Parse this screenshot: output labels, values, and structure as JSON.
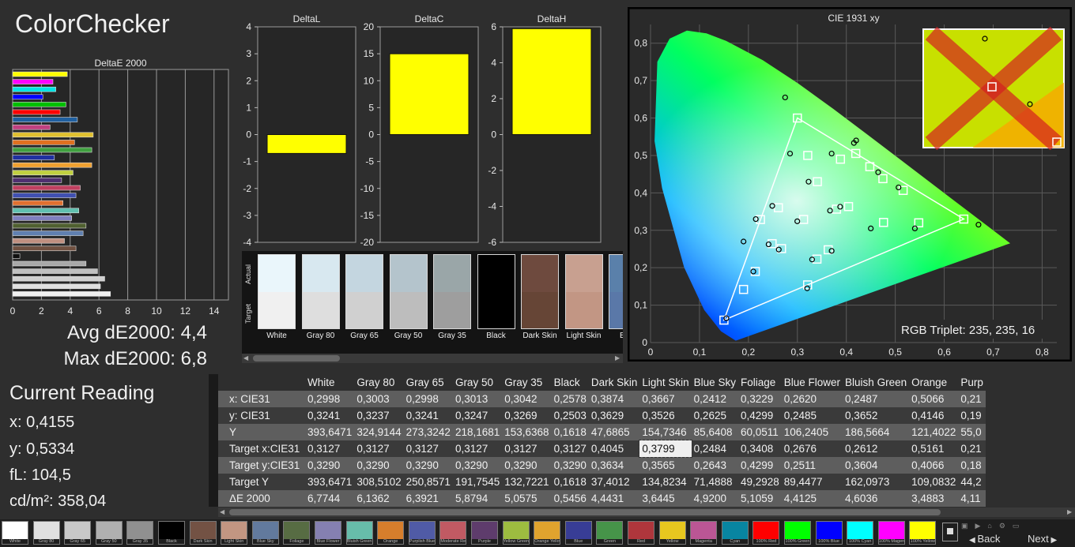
{
  "app": {
    "title": "ColorChecker"
  },
  "colors": {
    "accent_yellow": "#ffff00",
    "background": "#2e2e2e",
    "grid": "#9a9a9a"
  },
  "summary": {
    "avg": "Avg dE2000: 4,4",
    "max": "Max dE2000: 6,8"
  },
  "current_reading": {
    "title": "Current Reading",
    "x": "x: 0,4155",
    "y": "y: 0,5334",
    "fl": "fL: 104,5",
    "cdm2": "cd/m²: 358,04"
  },
  "chart_data": [
    {
      "type": "bar",
      "orientation": "horizontal",
      "title": "DeltaE 2000",
      "xlim": [
        0,
        15
      ],
      "xticks": [
        "0",
        "2",
        "4",
        "6",
        "8",
        "10",
        "12",
        "14"
      ],
      "bars": [
        {
          "color": "#ffff00",
          "value": 3.8
        },
        {
          "color": "#ff00ff",
          "value": 2.8
        },
        {
          "color": "#00e5e5",
          "value": 3.0
        },
        {
          "color": "#0000ff",
          "value": 2.1
        },
        {
          "color": "#00c000",
          "value": 3.7
        },
        {
          "color": "#ff0000",
          "value": 3.3
        },
        {
          "color": "#2060a0",
          "value": 4.5
        },
        {
          "color": "#c04080",
          "value": 2.6
        },
        {
          "color": "#e0c030",
          "value": 5.6
        },
        {
          "color": "#e07020",
          "value": 4.3
        },
        {
          "color": "#40a040",
          "value": 5.5
        },
        {
          "color": "#2030a0",
          "value": 2.9
        },
        {
          "color": "#f0a030",
          "value": 5.5
        },
        {
          "color": "#c0d040",
          "value": 4.2
        },
        {
          "color": "#503070",
          "value": 3.4
        },
        {
          "color": "#c04060",
          "value": 4.7
        },
        {
          "color": "#4050b0",
          "value": 4.4
        },
        {
          "color": "#e07030",
          "value": 3.5
        },
        {
          "color": "#60c0b0",
          "value": 4.6
        },
        {
          "color": "#8080c0",
          "value": 4.1
        },
        {
          "color": "#506030",
          "value": 5.1
        },
        {
          "color": "#6080b0",
          "value": 4.9
        },
        {
          "color": "#c09080",
          "value": 3.6
        },
        {
          "color": "#705040",
          "value": 4.4
        },
        {
          "color": "#101010",
          "value": 0.5
        },
        {
          "color": "#a8a8a8",
          "value": 5.1
        },
        {
          "color": "#c0c0c0",
          "value": 5.9
        },
        {
          "color": "#d0d0d0",
          "value": 6.4
        },
        {
          "color": "#e0e0e0",
          "value": 6.1
        },
        {
          "color": "#f0f0f0",
          "value": 6.8
        }
      ]
    },
    {
      "type": "bar",
      "title": "DeltaL",
      "ylim": [
        -4,
        4
      ],
      "yticks": [
        "4",
        "3",
        "2",
        "1",
        "0",
        "-1",
        "-2",
        "-3",
        "-4"
      ],
      "values": [
        -0.7
      ]
    },
    {
      "type": "bar",
      "title": "DeltaC",
      "ylim": [
        -20,
        20
      ],
      "yticks": [
        "20",
        "15",
        "10",
        "5",
        "0",
        "-5",
        "-10",
        "-15",
        "-20"
      ],
      "values": [
        15
      ]
    },
    {
      "type": "bar",
      "title": "DeltaH",
      "ylim": [
        -6,
        6
      ],
      "yticks": [
        "6",
        "4",
        "2",
        "0",
        "-2",
        "-4",
        "-6"
      ],
      "values": [
        5.9
      ]
    },
    {
      "type": "scatter",
      "title": "CIE 1931 xy",
      "xlim": [
        0,
        0.83
      ],
      "ylim": [
        0,
        0.85
      ],
      "xticks": [
        "0",
        "0,1",
        "0,2",
        "0,3",
        "0,4",
        "0,5",
        "0,6",
        "0,7",
        "0,8"
      ],
      "yticks": [
        "0,8",
        "0,7",
        "0,6",
        "0,5",
        "0,4",
        "0,3",
        "0,2",
        "0,1",
        "0"
      ],
      "gamut": [
        [
          0.64,
          0.33
        ],
        [
          0.3,
          0.6
        ],
        [
          0.15,
          0.06
        ]
      ],
      "targets": [
        [
          0.3127,
          0.329
        ],
        [
          0.4045,
          0.3634
        ],
        [
          0.3799,
          0.3565
        ],
        [
          0.2484,
          0.2643
        ],
        [
          0.3408,
          0.4299
        ],
        [
          0.2676,
          0.2511
        ],
        [
          0.2612,
          0.3604
        ],
        [
          0.5161,
          0.4066
        ],
        [
          0.214,
          0.19
        ],
        [
          0.476,
          0.321
        ],
        [
          0.34,
          0.223
        ],
        [
          0.388,
          0.49
        ],
        [
          0.4747,
          0.438
        ],
        [
          0.19,
          0.142
        ],
        [
          0.3212,
          0.5
        ],
        [
          0.5479,
          0.32
        ],
        [
          0.448,
          0.47
        ],
        [
          0.363,
          0.248
        ],
        [
          0.3,
          0.6
        ],
        [
          0.64,
          0.33
        ],
        [
          0.15,
          0.06
        ],
        [
          0.4193,
          0.5053
        ],
        [
          0.3209,
          0.1541
        ],
        [
          0.2246,
          0.3287
        ]
      ],
      "measured": [
        [
          0.2998,
          0.3241
        ],
        [
          0.3874,
          0.3629
        ],
        [
          0.3667,
          0.3526
        ],
        [
          0.2412,
          0.2625
        ],
        [
          0.3229,
          0.4299
        ],
        [
          0.262,
          0.2485
        ],
        [
          0.2487,
          0.3652
        ],
        [
          0.5066,
          0.4146
        ],
        [
          0.21,
          0.19
        ],
        [
          0.45,
          0.305
        ],
        [
          0.33,
          0.222
        ],
        [
          0.37,
          0.505
        ],
        [
          0.465,
          0.455
        ],
        [
          0.19,
          0.27
        ],
        [
          0.285,
          0.505
        ],
        [
          0.54,
          0.305
        ],
        [
          0.42,
          0.54
        ],
        [
          0.37,
          0.245
        ],
        [
          0.275,
          0.655
        ],
        [
          0.67,
          0.315
        ],
        [
          0.155,
          0.065
        ],
        [
          0.4155,
          0.5334
        ],
        [
          0.32,
          0.145
        ],
        [
          0.215,
          0.33
        ]
      ],
      "annotation": "RGB Triplet: 235, 235, 16"
    }
  ],
  "swatches": {
    "actual_label": "Actual",
    "target_label": "Target",
    "items": [
      {
        "label": "White",
        "actual": "#eaf6fb",
        "target": "#f0f0f0"
      },
      {
        "label": "Gray 80",
        "actual": "#d8e8f0",
        "target": "#dedede"
      },
      {
        "label": "Gray 65",
        "actual": "#c4d6e0",
        "target": "#d0d0d0"
      },
      {
        "label": "Gray 50",
        "actual": "#b4c4cc",
        "target": "#bdbdbd"
      },
      {
        "label": "Gray 35",
        "actual": "#9aa6a8",
        "target": "#9e9e9e"
      },
      {
        "label": "Black",
        "actual": "#000000",
        "target": "#000000"
      },
      {
        "label": "Dark Skin",
        "actual": "#6e4a3e",
        "target": "#664536"
      },
      {
        "label": "Light Skin",
        "actual": "#c8a090",
        "target": "#c29684"
      },
      {
        "label": "Blue",
        "actual": "#5a80aa",
        "target": "#5a78a8"
      }
    ]
  },
  "table": {
    "columns": [
      "",
      "White",
      "Gray 80",
      "Gray 65",
      "Gray 50",
      "Gray 35",
      "Black",
      "Dark Skin",
      "Light Skin",
      "Blue Sky",
      "Foliage",
      "Blue Flower",
      "Bluish Green",
      "Orange",
      "Purp"
    ],
    "rows": [
      {
        "label": "x: CIE31",
        "cells": [
          "0,2998",
          "0,3003",
          "0,2998",
          "0,3013",
          "0,3042",
          "0,2578",
          "0,3874",
          "0,3667",
          "0,2412",
          "0,3229",
          "0,2620",
          "0,2487",
          "0,5066",
          "0,21"
        ]
      },
      {
        "label": "y: CIE31",
        "cells": [
          "0,3241",
          "0,3237",
          "0,3241",
          "0,3247",
          "0,3269",
          "0,2503",
          "0,3629",
          "0,3526",
          "0,2625",
          "0,4299",
          "0,2485",
          "0,3652",
          "0,4146",
          "0,19"
        ]
      },
      {
        "label": "Y",
        "cells": [
          "393,6471",
          "324,9144",
          "273,3242",
          "218,1681",
          "153,6368",
          "0,1618",
          "47,6865",
          "154,7346",
          "85,6408",
          "60,0511",
          "106,2405",
          "186,5664",
          "121,4022",
          "55,0"
        ]
      },
      {
        "label": "Target x:CIE31",
        "cells": [
          "0,3127",
          "0,3127",
          "0,3127",
          "0,3127",
          "0,3127",
          "0,3127",
          "0,4045",
          "0,3799",
          "0,2484",
          "0,3408",
          "0,2676",
          "0,2612",
          "0,5161",
          "0,21"
        ]
      },
      {
        "label": "Target y:CIE31",
        "cells": [
          "0,3290",
          "0,3290",
          "0,3290",
          "0,3290",
          "0,3290",
          "0,3290",
          "0,3634",
          "0,3565",
          "0,2643",
          "0,4299",
          "0,2511",
          "0,3604",
          "0,4066",
          "0,18"
        ]
      },
      {
        "label": "Target Y",
        "cells": [
          "393,6471",
          "308,5102",
          "250,8571",
          "191,7545",
          "132,7221",
          "0,1618",
          "37,4012",
          "134,8234",
          "71,4888",
          "49,2928",
          "89,4477",
          "162,0973",
          "109,0832",
          "44,2"
        ]
      },
      {
        "label": "ΔE 2000",
        "cells": [
          "6,7744",
          "6,1362",
          "6,3921",
          "5,8794",
          "5,0575",
          "0,5456",
          "4,4431",
          "3,6445",
          "4,9200",
          "5,1059",
          "4,4125",
          "4,6036",
          "3,4883",
          "4,11"
        ]
      }
    ]
  },
  "strip": [
    {
      "label": "White",
      "color": "#ffffff"
    },
    {
      "label": "Gray 80",
      "color": "#e0e0e0"
    },
    {
      "label": "Gray 65",
      "color": "#c8c8c8"
    },
    {
      "label": "Gray 50",
      "color": "#b0b0b0"
    },
    {
      "label": "Gray 35",
      "color": "#909090"
    },
    {
      "label": "Black",
      "color": "#000000"
    },
    {
      "label": "Dark Skin",
      "color": "#735244"
    },
    {
      "label": "Light Skin",
      "color": "#c29682"
    },
    {
      "label": "Blue Sky",
      "color": "#627a9d"
    },
    {
      "label": "Foliage",
      "color": "#576c43"
    },
    {
      "label": "Blue Flower",
      "color": "#8580b1"
    },
    {
      "label": "Bluish Green",
      "color": "#67bdaa"
    },
    {
      "label": "Orange",
      "color": "#d67e2c"
    },
    {
      "label": "Purplish Blue",
      "color": "#505ba6"
    },
    {
      "label": "Moderate Red",
      "color": "#c15a63"
    },
    {
      "label": "Purple",
      "color": "#5e3c6c"
    },
    {
      "label": "Yellow Green",
      "color": "#9dbc40"
    },
    {
      "label": "Orange Yellow",
      "color": "#e0a32e"
    },
    {
      "label": "Blue",
      "color": "#383d96"
    },
    {
      "label": "Green",
      "color": "#469449"
    },
    {
      "label": "Red",
      "color": "#af363c"
    },
    {
      "label": "Yellow",
      "color": "#e7c71f"
    },
    {
      "label": "Magenta",
      "color": "#bb5695"
    },
    {
      "label": "Cyan",
      "color": "#0885a1"
    },
    {
      "label": "100% Red",
      "color": "#ff0000"
    },
    {
      "label": "100% Green",
      "color": "#00ff00"
    },
    {
      "label": "100% Blue",
      "color": "#0000ff"
    },
    {
      "label": "100% Cyan",
      "color": "#00ffff"
    },
    {
      "label": "100% Magenta",
      "color": "#ff00ff"
    },
    {
      "label": "100% Yellow",
      "color": "#ffff00"
    }
  ],
  "nav": {
    "back": "Back",
    "next": "Next"
  }
}
